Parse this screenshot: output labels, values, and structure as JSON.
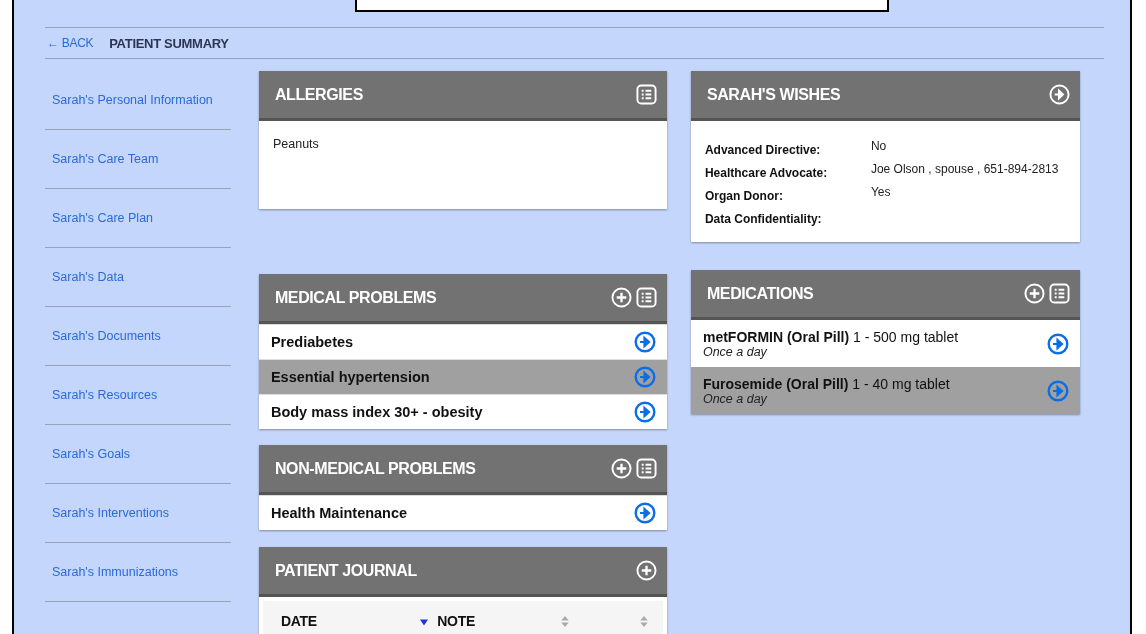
{
  "header": {
    "back_link": "← BACK",
    "title": "PATIENT SUMMARY"
  },
  "sidebar": {
    "items": [
      {
        "label": "Sarah's Personal Information"
      },
      {
        "label": "Sarah's Care Team"
      },
      {
        "label": "Sarah's Care Plan"
      },
      {
        "label": "Sarah's Data"
      },
      {
        "label": "Sarah's Documents"
      },
      {
        "label": "Sarah's Resources"
      },
      {
        "label": "Sarah's Goals"
      },
      {
        "label": "Sarah's Interventions"
      },
      {
        "label": "Sarah's Immunizations"
      }
    ]
  },
  "allergies": {
    "title": "ALLERGIES",
    "actions": [
      {
        "kind": "list"
      }
    ],
    "items": [
      "Peanuts"
    ]
  },
  "medical_problems": {
    "title": "MEDICAL PROBLEMS",
    "actions": [
      {
        "kind": "add"
      },
      {
        "kind": "list"
      }
    ],
    "rows": [
      {
        "label": "Prediabetes",
        "selected": false
      },
      {
        "label": "Essential hypertension",
        "selected": true
      },
      {
        "label": "Body mass index 30+ - obesity",
        "selected": false
      }
    ]
  },
  "non_medical_problems": {
    "title": "NON-MEDICAL PROBLEMS",
    "actions": [
      {
        "kind": "add"
      },
      {
        "kind": "list"
      }
    ],
    "rows": [
      {
        "label": "Health Maintenance",
        "selected": false
      }
    ]
  },
  "patient_journal": {
    "title": "PATIENT JOURNAL",
    "actions": [
      {
        "kind": "add"
      }
    ],
    "columns": [
      {
        "label": "DATE",
        "kind": "sorted_descending"
      },
      {
        "label": "NOTE",
        "kind": "sortable"
      },
      {
        "kind": "sortable"
      }
    ]
  },
  "wishes": {
    "title": "SARAH'S WISHES",
    "actions": [
      {
        "kind": "go"
      }
    ],
    "fields": [
      {
        "label": "Advanced Directive:",
        "value": "No"
      },
      {
        "label": "Healthcare Advocate:",
        "value": "Joe Olson , spouse , 651-894-2813"
      },
      {
        "label": "Organ Donor:",
        "value": "Yes"
      },
      {
        "label": "Data Confidentiality:"
      }
    ]
  },
  "medications": {
    "title": "MEDICATIONS",
    "actions": [
      {
        "kind": "add"
      },
      {
        "kind": "list"
      }
    ],
    "rows": [
      {
        "name": "**metFORMIN (Oral Pill)** 1 - 500 mg tablet",
        "frequency": "Once a day",
        "selected": false
      },
      {
        "name": "**Furosemide (Oral Pill)** 1 - 40 mg tablet",
        "frequency": "Once a day",
        "selected": true
      }
    ]
  }
}
